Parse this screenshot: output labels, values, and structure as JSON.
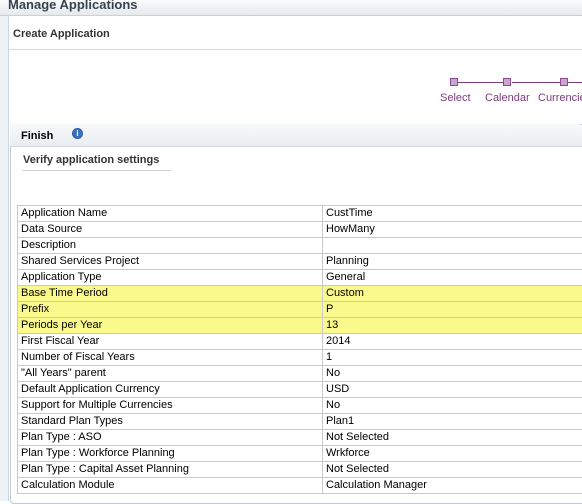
{
  "header": {
    "title": "Manage Applications"
  },
  "section": {
    "title": "Create Application"
  },
  "train": {
    "stops": [
      "Select",
      "Calendar",
      "Currencies"
    ]
  },
  "finish": {
    "label": "Finish",
    "info_icon": "info-icon",
    "verify_title": "Verify application settings"
  },
  "settings": [
    {
      "name": "Application Name",
      "value": "CustTime",
      "highlighted": false
    },
    {
      "name": "Data Source",
      "value": "HowMany",
      "highlighted": false
    },
    {
      "name": "Description",
      "value": "",
      "highlighted": false
    },
    {
      "name": "Shared Services Project",
      "value": "Planning",
      "highlighted": false
    },
    {
      "name": "Application Type",
      "value": "General",
      "highlighted": false
    },
    {
      "name": "Base Time Period",
      "value": "Custom",
      "highlighted": true
    },
    {
      "name": "Prefix",
      "value": "P",
      "highlighted": true
    },
    {
      "name": "Periods per Year",
      "value": "13",
      "highlighted": true
    },
    {
      "name": "First Fiscal Year",
      "value": "2014",
      "highlighted": false
    },
    {
      "name": "Number of Fiscal Years",
      "value": "1",
      "highlighted": false
    },
    {
      "name": "\"All Years\" parent",
      "value": "No",
      "highlighted": false
    },
    {
      "name": "Default Application Currency",
      "value": "USD",
      "highlighted": false
    },
    {
      "name": "Support for Multiple Currencies",
      "value": "No",
      "highlighted": false
    },
    {
      "name": "Standard Plan Types",
      "value": "Plan1",
      "highlighted": false
    },
    {
      "name": "Plan Type : ASO",
      "value": "Not Selected",
      "highlighted": false
    },
    {
      "name": "Plan Type : Workforce Planning",
      "value": "Wrkforce",
      "highlighted": false
    },
    {
      "name": "Plan Type : Capital Asset Planning",
      "value": "Not Selected",
      "highlighted": false
    },
    {
      "name": "Calculation Module",
      "value": "Calculation Manager",
      "highlighted": false
    }
  ],
  "colors": {
    "highlight": "#fafa8c",
    "train_accent": "#7a3b80",
    "info_blue": "#3a73c4"
  }
}
